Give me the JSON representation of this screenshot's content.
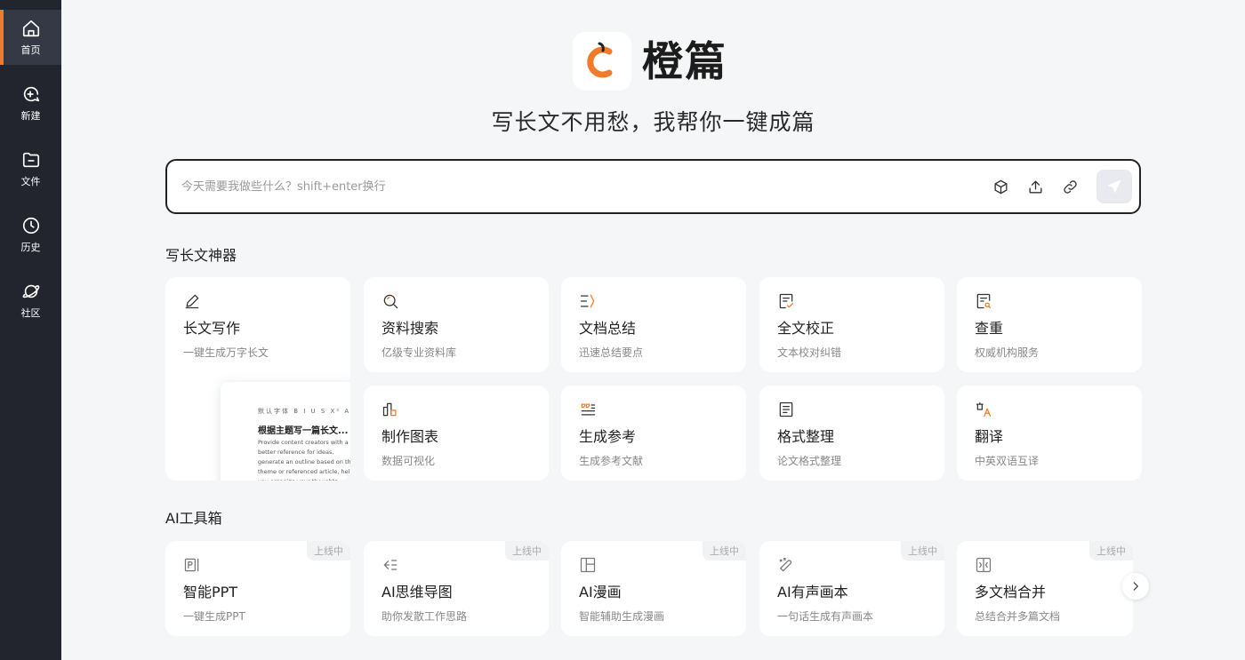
{
  "sidebar": {
    "items": [
      {
        "label": "首页",
        "icon": "home-icon",
        "active": true
      },
      {
        "label": "新建",
        "icon": "new-chat-icon"
      },
      {
        "label": "文件",
        "icon": "folder-icon"
      },
      {
        "label": "历史",
        "icon": "clock-icon"
      },
      {
        "label": "社区",
        "icon": "planet-icon"
      }
    ]
  },
  "brand": {
    "name": "橙篇",
    "tagline": "写长文不用愁，我帮你一键成篇",
    "accent": "#f07b2b"
  },
  "search": {
    "placeholder": "今天需要我做些什么？shift+enter换行"
  },
  "writing": {
    "title": "写长文神器",
    "cards": [
      {
        "title": "长文写作",
        "subtitle": "一键生成万字长文",
        "icon": "pencil-icon"
      },
      {
        "title": "资料搜索",
        "subtitle": "亿级专业资料库",
        "icon": "search-icon"
      },
      {
        "title": "文档总结",
        "subtitle": "迅速总结要点",
        "icon": "summary-icon"
      },
      {
        "title": "全文校正",
        "subtitle": "文本校对纠错",
        "icon": "proofread-icon"
      },
      {
        "title": "查重",
        "subtitle": "权威机构服务",
        "icon": "plagiarism-icon"
      },
      {
        "title": "制作图表",
        "subtitle": "数据可视化",
        "icon": "chart-icon"
      },
      {
        "title": "生成参考",
        "subtitle": "生成参考文献",
        "icon": "quote-icon"
      },
      {
        "title": "格式整理",
        "subtitle": "论文格式整理",
        "icon": "format-icon"
      },
      {
        "title": "翻译",
        "subtitle": "中英双语互译",
        "icon": "translate-icon"
      }
    ],
    "preview": {
      "toolbar": "默认字体 B I U S X² A",
      "title": "根据主题写一篇长文...",
      "body": "Provide content creators with a better reference for ideas, generate an outline based on the theme or referenced article, help you organize your thoughts, and generate it"
    }
  },
  "tools": {
    "title": "AI工具箱",
    "badge": "上线中",
    "cards": [
      {
        "title": "智能PPT",
        "subtitle": "一键生成PPT",
        "icon": "ppt-icon"
      },
      {
        "title": "AI思维导图",
        "subtitle": "助你发散工作思路",
        "icon": "mindmap-icon"
      },
      {
        "title": "AI漫画",
        "subtitle": "智能辅助生成漫画",
        "icon": "comic-icon"
      },
      {
        "title": "AI有声画本",
        "subtitle": "一句话生成有声画本",
        "icon": "audiobook-icon"
      },
      {
        "title": "多文档合并",
        "subtitle": "总结合并多篇文档",
        "icon": "merge-icon"
      }
    ]
  }
}
